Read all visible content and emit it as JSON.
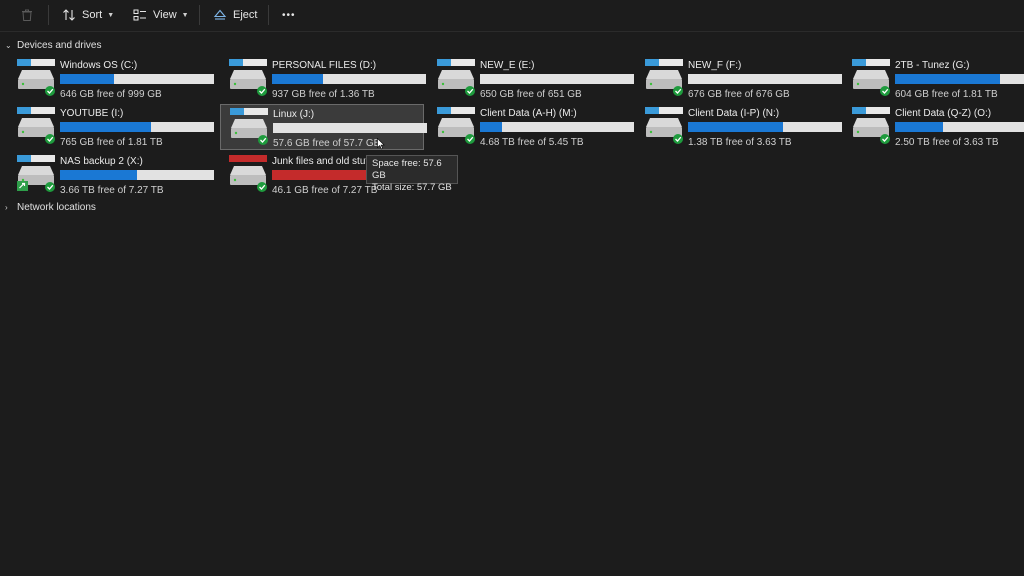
{
  "toolbar": {
    "sort_label": "Sort",
    "view_label": "View",
    "eject_label": "Eject",
    "more_label": "•••"
  },
  "sections": {
    "devices_label": "Devices and drives",
    "network_label": "Network locations"
  },
  "drives": [
    {
      "name": "Windows OS (C:)",
      "free_text": "646 GB free of 999 GB",
      "used_fraction": 0.35,
      "color": "#1a78d4",
      "os": true
    },
    {
      "name": "PERSONAL FILES (D:)",
      "free_text": "937 GB free of 1.36 TB",
      "used_fraction": 0.33,
      "color": "#1a78d4"
    },
    {
      "name": "NEW_E (E:)",
      "free_text": "650 GB free of 651 GB",
      "used_fraction": 0.0,
      "color": "#1a78d4"
    },
    {
      "name": "NEW_F (F:)",
      "free_text": "676 GB free of 676 GB",
      "used_fraction": 0.0,
      "color": "#1a78d4"
    },
    {
      "name": "2TB - Tunez (G:)",
      "free_text": "604 GB free of 1.81 TB",
      "used_fraction": 0.68,
      "color": "#1a78d4"
    },
    {
      "name": "YOUTUBE (I:)",
      "free_text": "765 GB free of 1.81 TB",
      "used_fraction": 0.59,
      "color": "#1a78d4"
    },
    {
      "name": "Linux (J:)",
      "free_text": "57.6 GB free of 57.7 GB",
      "used_fraction": 0.0,
      "color": "#1a78d4",
      "selected": true
    },
    {
      "name": "Client Data (A-H) (M:)",
      "free_text": "4.68 TB free of 5.45 TB",
      "used_fraction": 0.14,
      "color": "#1a78d4"
    },
    {
      "name": "Client Data (I-P) (N:)",
      "free_text": "1.38 TB free of 3.63 TB",
      "used_fraction": 0.62,
      "color": "#1a78d4"
    },
    {
      "name": "Client Data (Q-Z) (O:)",
      "free_text": "2.50 TB free of 3.63 TB",
      "used_fraction": 0.31,
      "color": "#1a78d4"
    },
    {
      "name": "NAS backup 2 (X:)",
      "free_text": "3.66 TB free of 7.27 TB",
      "used_fraction": 0.5,
      "color": "#1a78d4",
      "network": true
    },
    {
      "name": "Junk files and old stuff (",
      "free_text": "46.1 GB free of 7.27 TB",
      "used_fraction": 0.99,
      "color": "#c42b2b",
      "red": true
    }
  ],
  "tooltip": {
    "line1": "Space free: 57.6 GB",
    "line2": "Total size: 57.7 GB"
  }
}
